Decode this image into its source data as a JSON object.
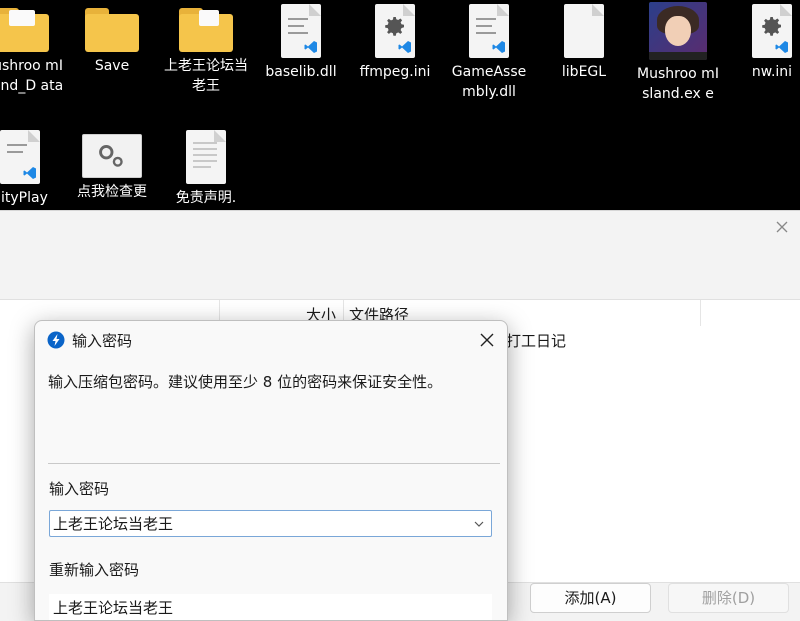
{
  "desktop": {
    "icons": [
      {
        "label": "Mushroo mIsland_D ata",
        "type": "folder"
      },
      {
        "label": "Save",
        "type": "folder"
      },
      {
        "label": "上老王论坛当老王",
        "type": "folder"
      },
      {
        "label": "baselib.dll",
        "type": "vs-file"
      },
      {
        "label": "ffmpeg.ini",
        "type": "settings-file"
      },
      {
        "label": "GameAsse mbly.dll",
        "type": "vs-file"
      },
      {
        "label": "libEGL",
        "type": "blank-file"
      },
      {
        "label": "Mushroo mIsland.ex e",
        "type": "app-avatar"
      },
      {
        "label": "nw.ini",
        "type": "settings-file"
      },
      {
        "label": "nityPlay",
        "type": "vs-file"
      },
      {
        "label": "点我检查更",
        "type": "settings-thumb"
      },
      {
        "label": "免责声明.",
        "type": "text-file"
      }
    ]
  },
  "main_dialog": {
    "columns": [
      "大小",
      "文件路径"
    ],
    "row_path": "打工日记",
    "add_button": "添加(A)",
    "delete_button": "删除(D)"
  },
  "password_dialog": {
    "title": "输入密码",
    "description": "输入压缩包密码。建议使用至少 8 位的密码来保证安全性。",
    "password_label": "输入密码",
    "password_value": "上老王论坛当老王",
    "confirm_label": "重新输入密码",
    "confirm_value": "上老王论坛当老王"
  },
  "colors": {
    "accent": "#0a64c8",
    "folder": "#f5c54b",
    "vs_blue": "#1e88e5"
  }
}
